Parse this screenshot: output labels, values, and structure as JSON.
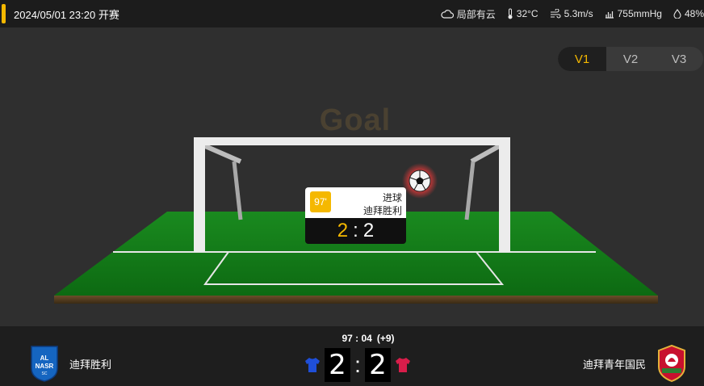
{
  "header": {
    "datetime": "2024/05/01 23:20",
    "status": "开赛",
    "accent_color": "#f5b800"
  },
  "weather": {
    "condition": "局部有云",
    "condition_icon": "cloud-icon",
    "temperature": "32°C",
    "temperature_icon": "thermometer-icon",
    "wind": "5.3m/s",
    "wind_icon": "wind-icon",
    "pressure": "755mmHg",
    "pressure_icon": "pressure-icon",
    "humidity": "48%",
    "humidity_icon": "droplet-icon"
  },
  "tabs": [
    {
      "label": "V1",
      "active": true
    },
    {
      "label": "V2",
      "active": false
    },
    {
      "label": "V3",
      "active": false
    }
  ],
  "pitch": {
    "event_title": "Goal",
    "ball_icon": "soccer-ball-icon"
  },
  "event_card": {
    "minute": "97'",
    "type": "进球",
    "team": "迪拜胜利",
    "score_home": "2",
    "score_away": "2",
    "separator": ":"
  },
  "match": {
    "clock": "97 : 04",
    "added_time": "(+9)",
    "home": {
      "name": "迪拜胜利",
      "logo": "al-nasr-logo",
      "logo_text": "AL NASR",
      "jersey_color": "#1f4fd8",
      "score": "2"
    },
    "away": {
      "name": "迪拜青年国民",
      "logo": "shabab-al-ahli-logo",
      "jersey_color": "#d81d4a",
      "score": "2"
    },
    "separator": ":"
  }
}
